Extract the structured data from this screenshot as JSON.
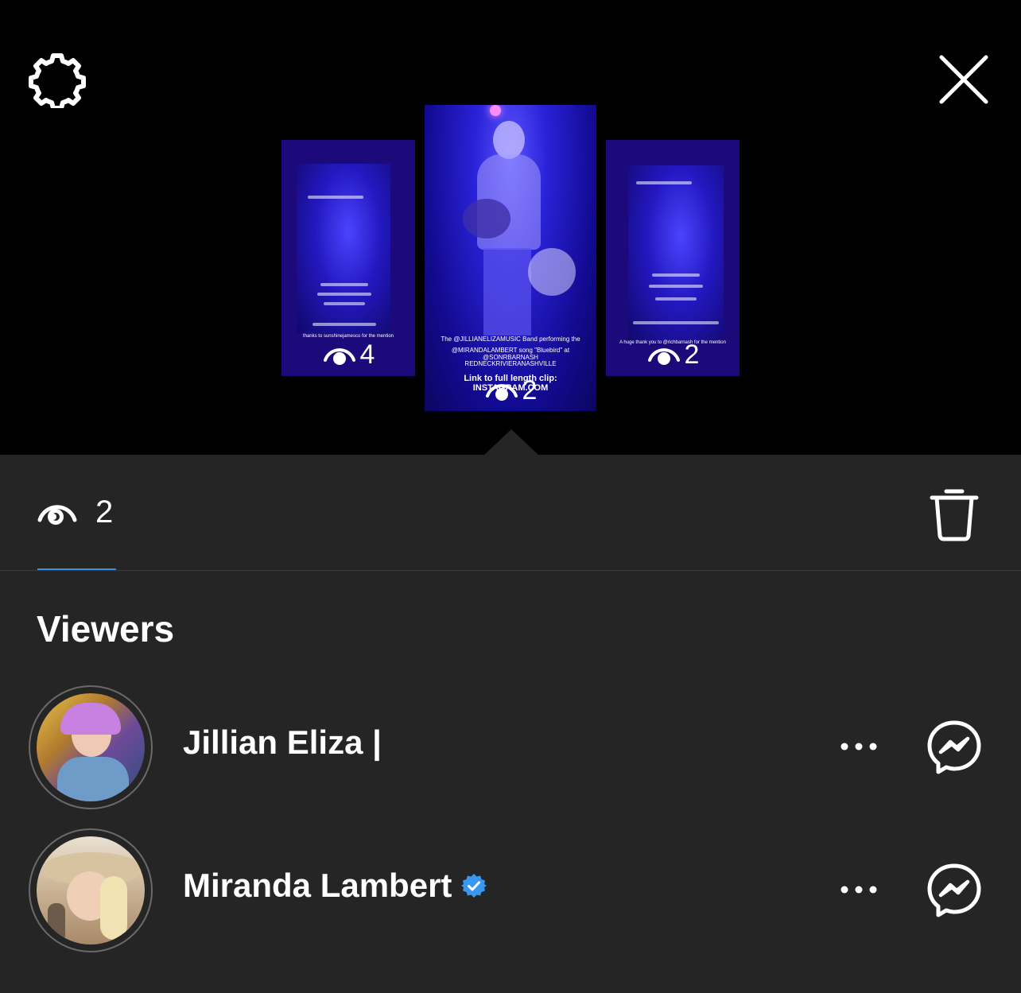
{
  "header": {
    "settings_icon": "gear-icon",
    "close_icon": "close-icon"
  },
  "stories": [
    {
      "position": "left",
      "views": "4",
      "caption_line": "thanks to sunshinejamesco for the mention"
    },
    {
      "position": "center",
      "views": "2",
      "caption_line1": "The @JILLIANELIZAMUSIC Band performing the",
      "caption_line2": "@MIRANDALAMBERT song \"Bluebird\" at @SONRBARNASH",
      "caption_line3": "REDNECKRIVIERANASHVILLE",
      "caption_line4": "Link to full length clip: INSTAGRAM.COM"
    },
    {
      "position": "right",
      "views": "2",
      "caption_line": "A huge thank you to @richbarnash for the mention"
    }
  ],
  "summary": {
    "view_count": "2",
    "eye_icon": "eye-icon",
    "delete_icon": "trash-icon"
  },
  "viewers": {
    "title": "Viewers",
    "list": [
      {
        "name": "Jillian Eliza |",
        "verified": false
      },
      {
        "name": "Miranda Lambert",
        "verified": true
      }
    ]
  },
  "colors": {
    "panel_bg": "#252525",
    "accent_underline": "#3a8dde",
    "verified_blue": "#3897f0"
  }
}
